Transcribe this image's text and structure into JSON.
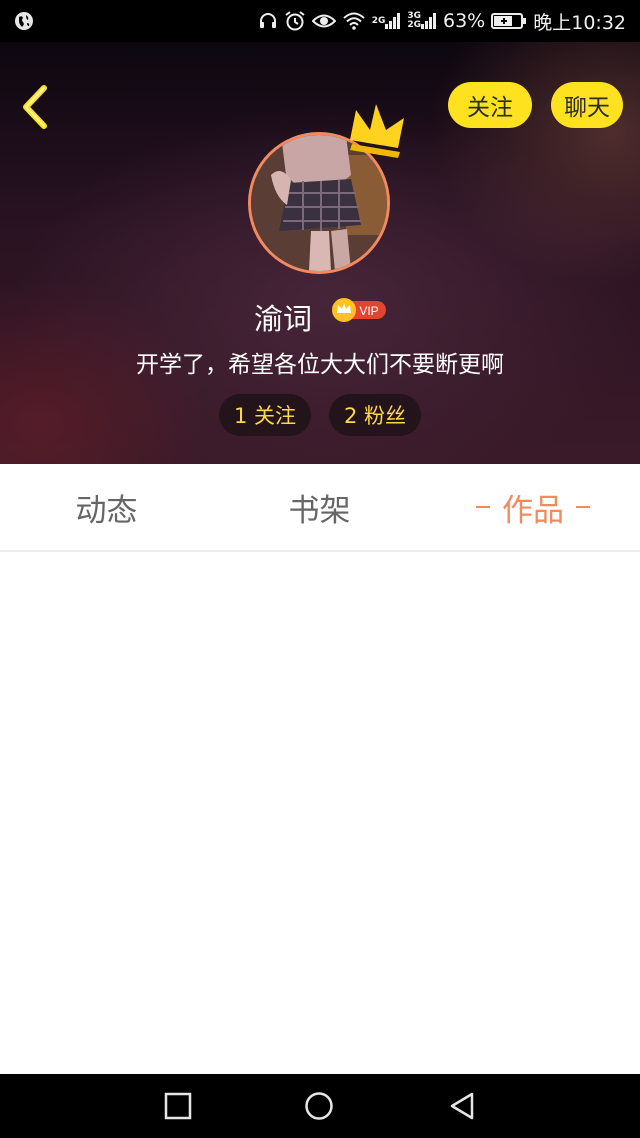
{
  "status_bar": {
    "battery": "63%",
    "time": "晚上10:32",
    "net_top_1": "2G",
    "net_top_2": "3G",
    "net_bottom_2": "2G",
    "icons": [
      "globe-icon",
      "headset-icon",
      "alarm-icon",
      "eye-icon",
      "wifi-icon",
      "signal-icon",
      "battery-icon"
    ]
  },
  "header": {
    "follow_label": "关注",
    "chat_label": "聊天",
    "username": "渝词",
    "vip_label": "VIP",
    "bio": "开学了，希望各位大大们不要断更啊",
    "following_label": "1 关注",
    "fans_label": "2 粉丝"
  },
  "tabs": [
    {
      "label": "动态",
      "active": false
    },
    {
      "label": "书架",
      "active": false
    },
    {
      "label": "作品",
      "active": true
    }
  ],
  "colors": {
    "accent": "#f28a5f",
    "button_yellow": "#ffe21f",
    "stat_text": "#ffd84a"
  },
  "nav": [
    "recents-icon",
    "home-icon",
    "back-icon"
  ]
}
